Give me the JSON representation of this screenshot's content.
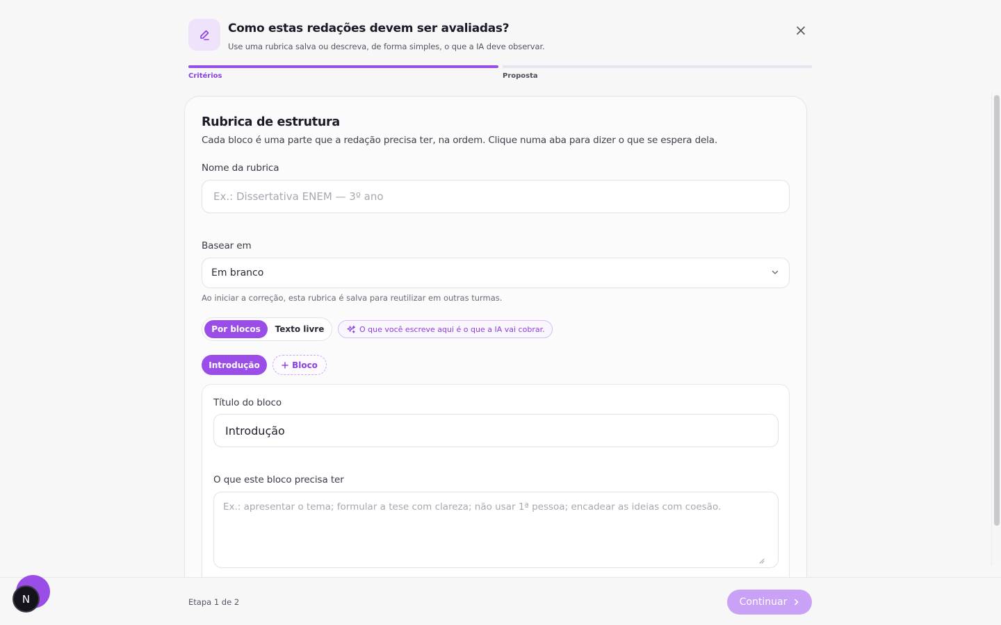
{
  "header": {
    "title": "Como estas redações devem ser avaliadas?",
    "subtitle": "Use uma rubrica salva ou descreva, de forma simples, o que a IA deve observar.",
    "icon": "pencil-icon",
    "close_icon": "close-icon"
  },
  "steps": [
    {
      "label": "Critérios",
      "state": "active"
    },
    {
      "label": "Proposta",
      "state": "pending"
    }
  ],
  "card": {
    "title": "Rubrica de estrutura",
    "description": "Cada bloco é uma parte que a redação precisa ter, na ordem. Clique numa aba para dizer o que se espera dela.",
    "rubric_name": {
      "label": "Nome da rubrica",
      "placeholder": "Ex.: Dissertativa ENEM — 3º ano",
      "value": ""
    },
    "base_on": {
      "label": "Basear em",
      "selected": "Em branco"
    },
    "hint": "Ao iniciar a correção, esta rubrica é salva para reutilizar em outras turmas.",
    "mode_toggle": {
      "options": [
        "Por blocos",
        "Texto livre"
      ],
      "selected": "Por blocos"
    },
    "ai_badge": "O que você escreve aqui é o que a IA vai cobrar.",
    "blocks": [
      "Introdução"
    ],
    "add_block_label": "Bloco",
    "block_editor": {
      "title_label": "Título do bloco",
      "title_value": "Introdução",
      "requirements_label": "O que este bloco precisa ter",
      "requirements_placeholder": "Ex.: apresentar o tema; formular a tese com clareza; não usar 1ª pessoa; encadear as ideias com coesão."
    }
  },
  "footer": {
    "step_count": "Etapa 1 de 2",
    "continue_label": "Continuar"
  },
  "overlay": {
    "dev_badge_letter": "N"
  },
  "colors": {
    "accent": "#9b4de8",
    "accent_light": "#efe3fc",
    "continue_disabled": "#c9a1f6"
  }
}
